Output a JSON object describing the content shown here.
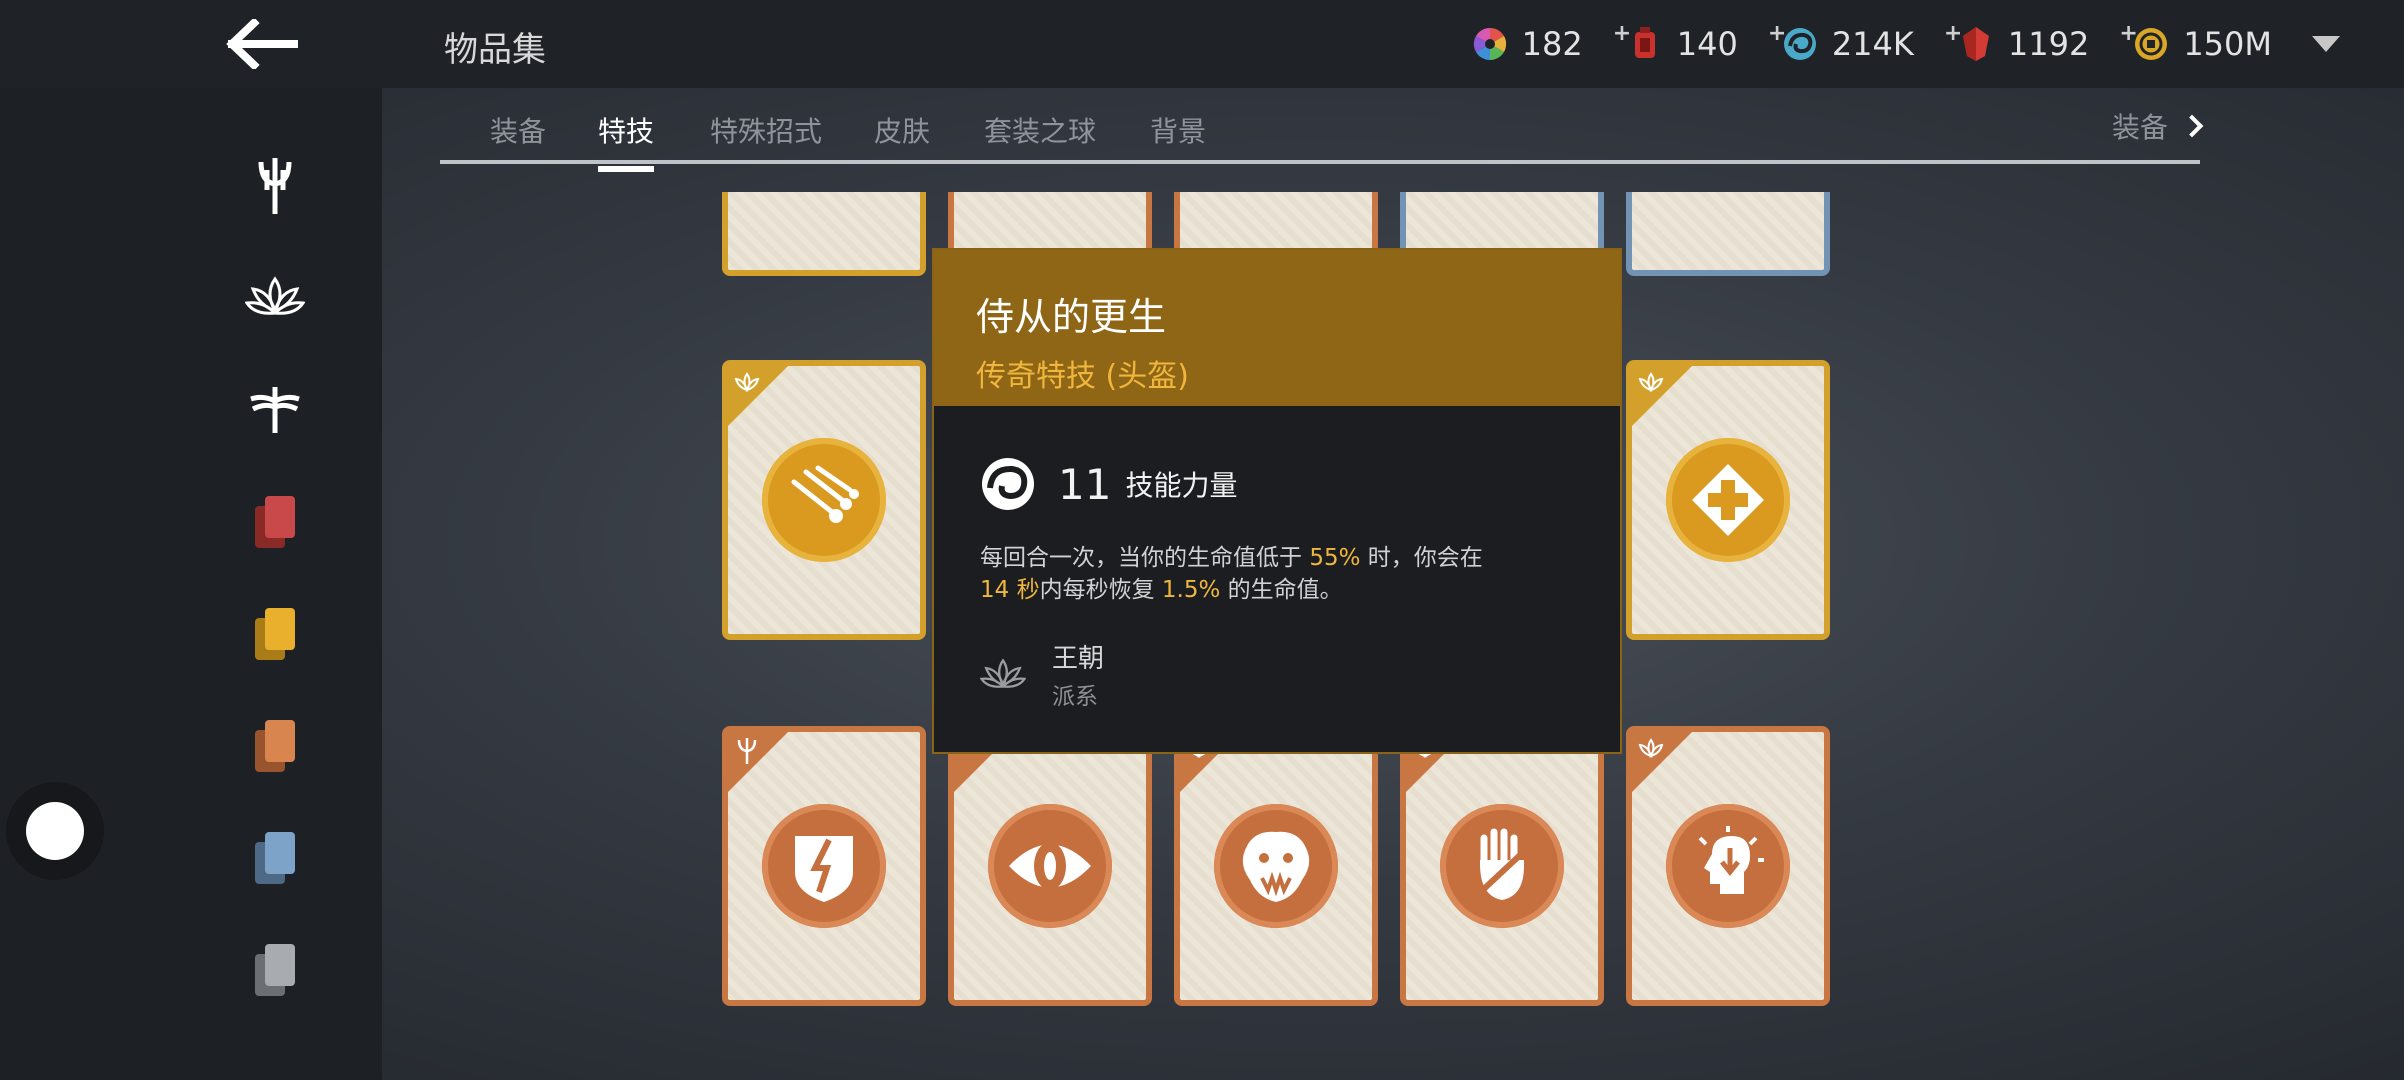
{
  "header": {
    "title": "物品集",
    "currencies": [
      {
        "icon": "color-wheel-icon",
        "value": "182",
        "plus": false
      },
      {
        "icon": "red-lantern-icon",
        "value": "140",
        "plus": true
      },
      {
        "icon": "blue-swirl-icon",
        "value": "214K",
        "plus": true
      },
      {
        "icon": "red-gem-icon",
        "value": "1192",
        "plus": true
      },
      {
        "icon": "gold-coin-icon",
        "value": "150M",
        "plus": true
      }
    ]
  },
  "tabs": {
    "items": [
      "装备",
      "特技",
      "特殊招式",
      "皮肤",
      "套装之球",
      "背景"
    ],
    "active_index": 1,
    "right_label": "装备"
  },
  "sidebar": {
    "icons": [
      "trident-icon",
      "lotus-icon",
      "dragonfly-icon",
      "red-cards-icon",
      "yellow-cards-icon",
      "orange-cards-icon",
      "blue-cards-icon",
      "gray-cards-icon"
    ]
  },
  "tooltip": {
    "name": "侍从的更生",
    "subtitle": "传奇特技 (头盔)",
    "stat_value": "11",
    "stat_label": "技能力量",
    "desc_1": "每回合一次，当你的生命值低于 ",
    "desc_hl1": "55%",
    "desc_2": " 时，你会在",
    "desc_hl2": "14 秒",
    "desc_3": "内每秒恢复 ",
    "desc_hl3": "1.5%",
    "desc_4": " 的生命值。",
    "faction_name": "王朝",
    "faction_type": "派系"
  },
  "colors": {
    "legendary": "#d3a12b",
    "epic": "#c87742",
    "rare": "#7393b5",
    "highlight": "#f0b73d",
    "tooltip_header": "#8f6516"
  }
}
